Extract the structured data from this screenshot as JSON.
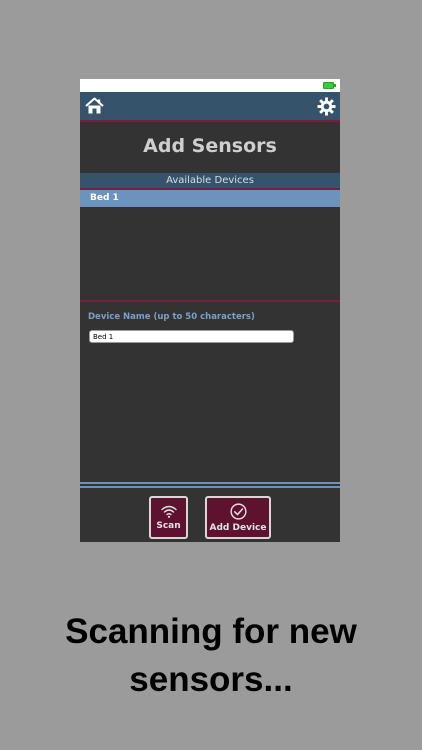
{
  "screen": {
    "title": "Add Sensors",
    "icons": {
      "home": "home-icon",
      "settings": "gear-icon",
      "battery": "battery-icon",
      "scan": "wifi-icon",
      "add": "checkmark-circle-icon"
    },
    "colors": {
      "nav": "#35536a",
      "accent": "#7c1d3b",
      "selected_row": "#6b93bd",
      "button": "#5e1230"
    }
  },
  "devices": {
    "header": "Available Devices",
    "items": [
      "Bed 1"
    ]
  },
  "device_name": {
    "label": "Device Name (up to 50 characters)",
    "value": "Bed 1"
  },
  "actions": {
    "scan_label": "Scan",
    "add_label": "Add Device"
  },
  "caption": "Scanning for new sensors..."
}
